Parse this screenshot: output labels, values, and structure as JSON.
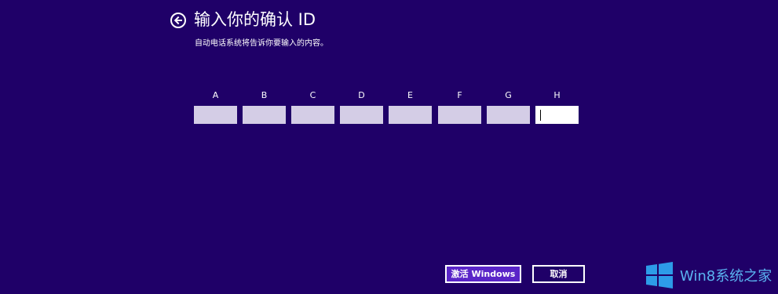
{
  "header": {
    "title": "输入你的确认 ID",
    "subtitle": "自动电话系统将告诉你要输入的内容。"
  },
  "id_fields": [
    {
      "label": "A",
      "value": ""
    },
    {
      "label": "B",
      "value": ""
    },
    {
      "label": "C",
      "value": ""
    },
    {
      "label": "D",
      "value": ""
    },
    {
      "label": "E",
      "value": ""
    },
    {
      "label": "F",
      "value": ""
    },
    {
      "label": "G",
      "value": ""
    },
    {
      "label": "H",
      "value": ""
    }
  ],
  "active_field": "H",
  "buttons": {
    "activate_label": "激活 Windows",
    "cancel_label": "取消"
  },
  "watermark": {
    "text": "Win8系统之家",
    "logo": "windows-logo-icon"
  },
  "colors": {
    "background": "#1f0068",
    "field_fill": "#d4cde6",
    "active_field_fill": "#ffffff",
    "primary_button": "#5a25c8",
    "watermark_blue": "#5ab4f0"
  }
}
